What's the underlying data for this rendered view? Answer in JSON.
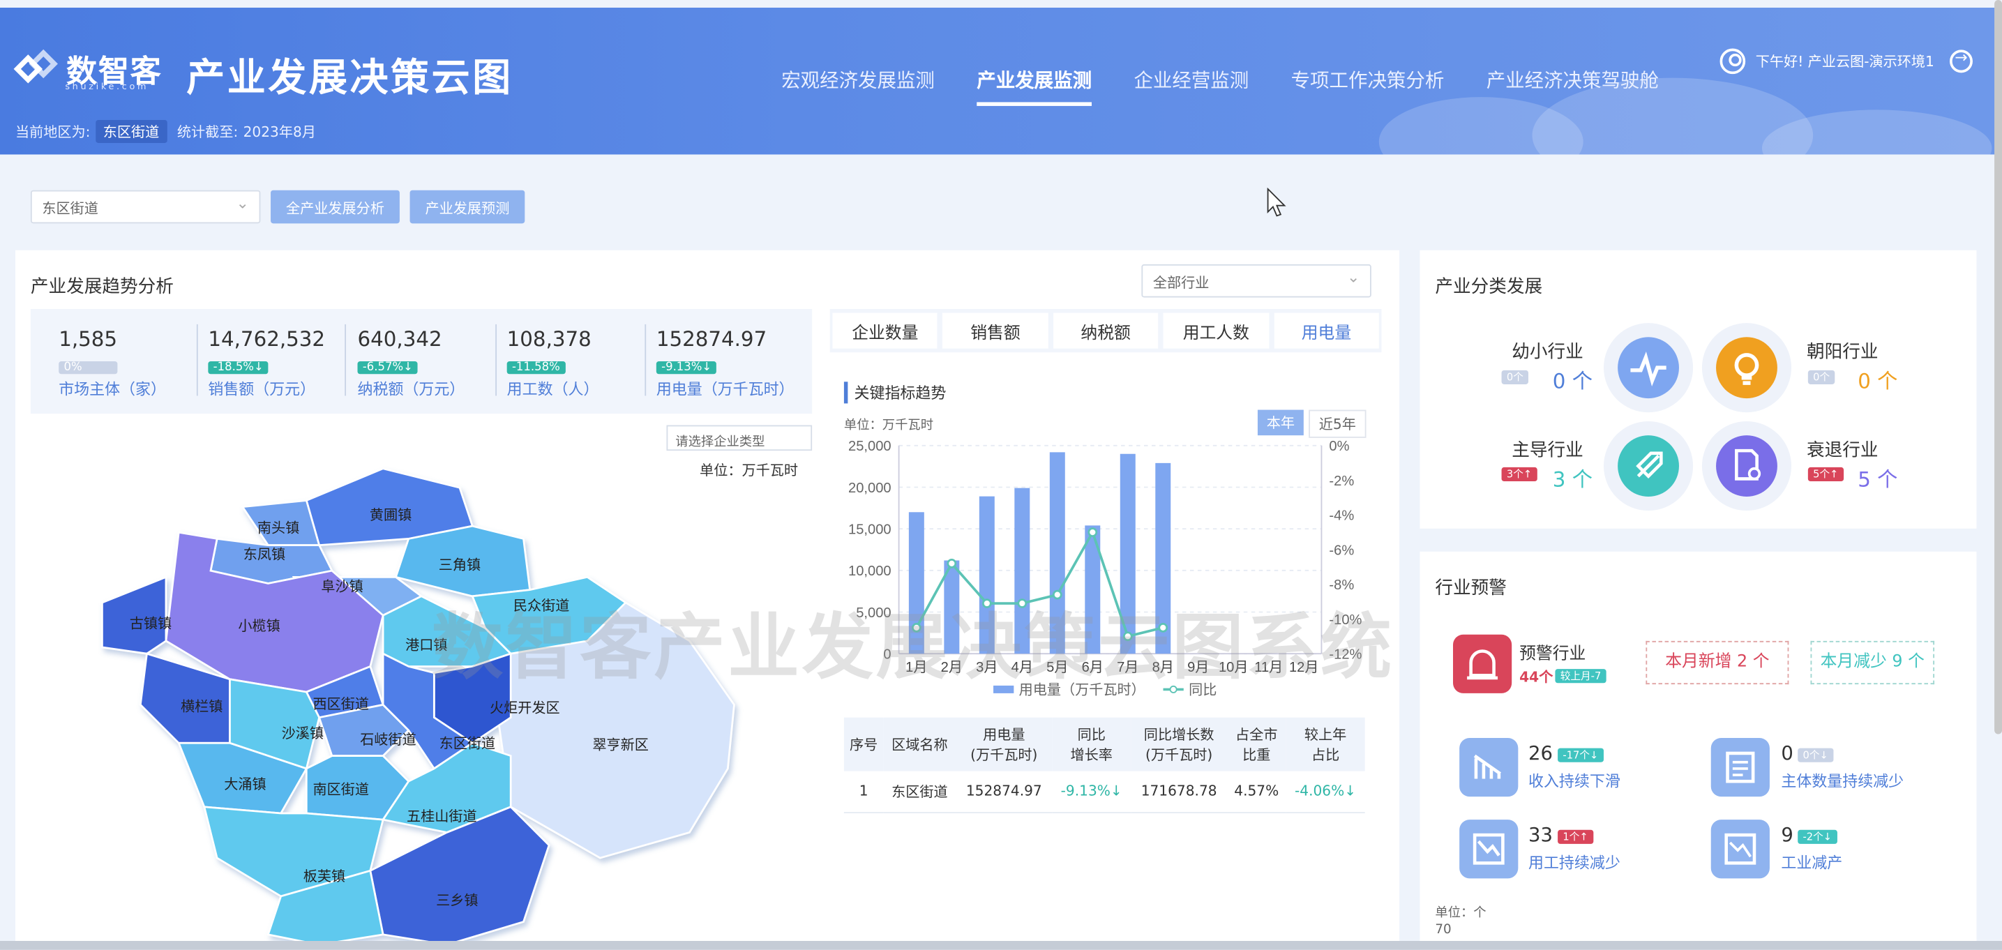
{
  "header": {
    "logo_text": "数智客",
    "logo_sub": "shuzike.com",
    "title": "产业发展决策云图",
    "nav": [
      {
        "label": "宏观经济发展监测",
        "active": false
      },
      {
        "label": "产业发展监测",
        "active": true
      },
      {
        "label": "企业经营监测",
        "active": false
      },
      {
        "label": "专项工作决策分析",
        "active": false
      },
      {
        "label": "产业经济决策驾驶舱",
        "active": false
      }
    ],
    "user_greeting": "下午好! 产业云图-演示环境1",
    "region_label": "当前地区为:",
    "region_value": "东区街道",
    "stat_label": "统计截至:",
    "stat_value": "2023年8月"
  },
  "toolbar": {
    "region_select": "东区街道",
    "btn_all": "全产业发展分析",
    "btn_forecast": "产业发展预测"
  },
  "trend": {
    "title": "产业发展趋势分析",
    "kpis": [
      {
        "value": "1,585",
        "badge": "0%",
        "badge_color": "#c9d3e6",
        "label": "市场主体（家）"
      },
      {
        "value": "14,762,532",
        "badge": "-18.5%↓",
        "badge_color": "#2fb6a6",
        "label": "销售额（万元）"
      },
      {
        "value": "640,342",
        "badge": "-6.57%↓",
        "badge_color": "#2fb6a6",
        "label": "纳税额（万元）"
      },
      {
        "value": "108,378",
        "badge": "-11.58%",
        "badge_color": "#2fb6a6",
        "label": "用工数（人）"
      },
      {
        "value": "152874.97",
        "badge": "-9.13%↓",
        "badge_color": "#2fb6a6",
        "label": "用电量（万千瓦时）"
      }
    ],
    "enterprise_type_placeholder": "请选择企业类型",
    "map_unit": "单位：万千瓦时",
    "industry_select": "全部行业"
  },
  "map": {
    "regions": [
      "南头镇",
      "黄圃镇",
      "东凤镇",
      "三角镇",
      "阜沙镇",
      "民众街道",
      "小榄镇",
      "古镇镇",
      "港口镇",
      "横栏镇",
      "西区街道",
      "火炬开发区",
      "沙溪镇",
      "石岐街道",
      "东区街道",
      "翠亨新区",
      "大涌镇",
      "南区街道",
      "五桂山街道",
      "板芙镇",
      "三乡镇"
    ]
  },
  "indicator_tabs": [
    "企业数量",
    "销售额",
    "纳税额",
    "用工人数",
    "用电量"
  ],
  "indicator_active": "用电量",
  "chart_data": {
    "type": "bar",
    "title": "关键指标趋势",
    "unit": "单位：万千瓦时",
    "toggle": [
      "本年",
      "近5年"
    ],
    "categories": [
      "1月",
      "2月",
      "3月",
      "4月",
      "5月",
      "6月",
      "7月",
      "8月",
      "9月",
      "10月",
      "11月",
      "12月"
    ],
    "series": [
      {
        "name": "用电量（万千瓦时）",
        "type": "bar",
        "axis": "left",
        "values": [
          17000,
          11200,
          18900,
          19900,
          24200,
          15400,
          24000,
          22900,
          null,
          null,
          null,
          null
        ]
      },
      {
        "name": "同比",
        "type": "line",
        "axis": "right",
        "values": [
          -10.5,
          -6.8,
          -9.1,
          -9.1,
          -8.6,
          -5.0,
          -11.0,
          -10.5,
          null,
          null,
          null,
          null
        ]
      }
    ],
    "ylim": [
      0,
      25000
    ],
    "yticks": [
      "25,000",
      "20,000",
      "15,000",
      "10,000",
      "5,000",
      "0"
    ],
    "y2lim": [
      -12,
      0
    ],
    "y2ticks": [
      "0%",
      "-2%",
      "-4%",
      "-6%",
      "-8%",
      "-10%",
      "-12%"
    ],
    "colors": {
      "bar": "#7ea6f0",
      "line": "#5cc3b5"
    },
    "legend": "bottom",
    "grid": true
  },
  "table": {
    "headers": [
      "序号",
      "区域名称",
      "用电量\n(万千瓦时)",
      "同比\n增长率",
      "同比增长数\n(万千瓦时)",
      "占全市\n比重",
      "较上年\n占比"
    ],
    "rows": [
      [
        "1",
        "东区街道",
        "152874.97",
        "-9.13%↓",
        "171678.78",
        "4.57%",
        "-4.06%↓"
      ]
    ]
  },
  "classification": {
    "title": "产业分类发展",
    "items": [
      {
        "name": "幼小行业",
        "chip": "0个",
        "count": "0 个",
        "color": "#7ea6f0",
        "icon": "pulse-icon"
      },
      {
        "name": "朝阳行业",
        "chip": "0个",
        "count": "0 个",
        "color": "#f0a020",
        "icon": "bulb-icon"
      },
      {
        "name": "主导行业",
        "chip": "3个↑",
        "count": "3 个",
        "color": "#40c4c0",
        "icon": "rocket-icon"
      },
      {
        "name": "衰退行业",
        "chip": "5个↑",
        "count": "5 个",
        "color": "#7a6ee8",
        "icon": "doc-gear-icon"
      }
    ]
  },
  "warning": {
    "title": "行业预警",
    "main_label": "预警行业",
    "main_count": "44个",
    "main_badge": "较上月-7",
    "new_this_month": "本月新增 2 个",
    "reduced_this_month": "本月减少 9 个",
    "metrics": [
      {
        "value": "26",
        "chip": "-17个↓",
        "label": "收入持续下滑",
        "icon": "bar-decline-icon"
      },
      {
        "value": "0",
        "chip": "0个↓",
        "label": "主体数量持续减少",
        "icon": "list-icon"
      },
      {
        "value": "33",
        "chip": "1个↑",
        "label": "用工持续减少",
        "icon": "trend-down-icon"
      },
      {
        "value": "9",
        "chip": "-2个↓",
        "label": "工业减产",
        "icon": "chart-down-icon"
      }
    ],
    "unit": "单位：个",
    "axis_top": "70"
  },
  "watermark": "数智客产业发展决策云图系统"
}
